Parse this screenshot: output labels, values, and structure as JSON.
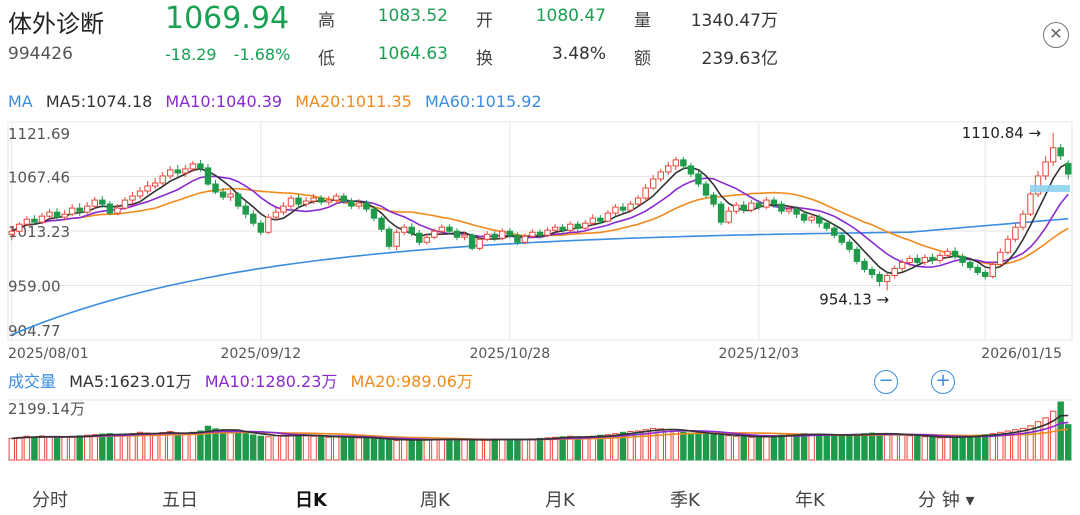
{
  "header": {
    "name": "体外诊断",
    "code": "994426",
    "price": "1069.94",
    "change": "-18.29",
    "change_pct": "-1.68%",
    "stats": [
      {
        "label": "高",
        "value": "1083.52",
        "color": "green"
      },
      {
        "label": "开",
        "value": "1080.47",
        "color": "green"
      },
      {
        "label": "量",
        "value": "1340.47万",
        "color": "dark"
      },
      {
        "label": "低",
        "value": "1064.63",
        "color": "green"
      },
      {
        "label": "换",
        "value": "3.48%",
        "color": "dark"
      },
      {
        "label": "额",
        "value": "239.63亿",
        "color": "dark"
      }
    ],
    "close_icon": "close-icon"
  },
  "ma_legend": {
    "label": "MA",
    "ma5": "MA5:1074.18",
    "ma10": "MA10:1040.39",
    "ma20": "MA20:1011.35",
    "ma60": "MA60:1015.92"
  },
  "vol_legend": {
    "label": "成交量",
    "ma5": "MA5:1623.01万",
    "ma10": "MA10:1280.23万",
    "ma20": "MA20:989.06万"
  },
  "zoom": {
    "minus": "−",
    "plus": "+"
  },
  "tabs": [
    {
      "label": "分时",
      "active": false
    },
    {
      "label": "五日",
      "active": false
    },
    {
      "label": "日K",
      "active": true
    },
    {
      "label": "周K",
      "active": false
    },
    {
      "label": "月K",
      "active": false
    },
    {
      "label": "季K",
      "active": false
    },
    {
      "label": "年K",
      "active": false
    },
    {
      "label": "分 钟 ▾",
      "active": false
    }
  ],
  "colors": {
    "up": "#e8473a",
    "down": "#1e9a4a",
    "ma5": "#333333",
    "ma10": "#8a2ad0",
    "ma20": "#f08a1c",
    "ma60": "#3a8de0",
    "grid": "#e6e6e6"
  },
  "chart_data": {
    "type": "candlestick",
    "y_ticks": [
      "1121.69",
      "1067.46",
      "1013.23",
      "959.00",
      "904.77"
    ],
    "ylim": [
      904.77,
      1121.69
    ],
    "x_ticks": [
      "2025/08/01",
      "2025/09/12",
      "2025/10/28",
      "2025/12/03",
      "2026/01/15"
    ],
    "annotations": [
      {
        "text": "1110.84",
        "value": 1110.84
      },
      {
        "text": "954.13",
        "value": 954.13
      }
    ],
    "volume_top_label": "2199.14万",
    "volume_max": 2199.14,
    "candles": [
      [
        1010,
        1013,
        1004,
        1018
      ],
      [
        1013,
        1020,
        1011,
        1022
      ],
      [
        1020,
        1025,
        1018,
        1028
      ],
      [
        1025,
        1022,
        1019,
        1029
      ],
      [
        1022,
        1028,
        1020,
        1031
      ],
      [
        1028,
        1032,
        1025,
        1035
      ],
      [
        1032,
        1027,
        1024,
        1036
      ],
      [
        1027,
        1030,
        1024,
        1034
      ],
      [
        1030,
        1036,
        1028,
        1040
      ],
      [
        1036,
        1032,
        1028,
        1041
      ],
      [
        1032,
        1038,
        1030,
        1042
      ],
      [
        1038,
        1044,
        1035,
        1047
      ],
      [
        1044,
        1040,
        1036,
        1048
      ],
      [
        1040,
        1031,
        1029,
        1043
      ],
      [
        1031,
        1036,
        1029,
        1040
      ],
      [
        1036,
        1044,
        1034,
        1047
      ],
      [
        1044,
        1048,
        1040,
        1052
      ],
      [
        1048,
        1053,
        1045,
        1057
      ],
      [
        1053,
        1058,
        1050,
        1063
      ],
      [
        1058,
        1061,
        1055,
        1066
      ],
      [
        1061,
        1068,
        1058,
        1072
      ],
      [
        1068,
        1074,
        1065,
        1078
      ],
      [
        1074,
        1071,
        1067,
        1079
      ],
      [
        1071,
        1075,
        1067,
        1079
      ],
      [
        1075,
        1080,
        1072,
        1083
      ],
      [
        1080,
        1076,
        1072,
        1084
      ],
      [
        1076,
        1060,
        1058,
        1080
      ],
      [
        1060,
        1052,
        1050,
        1064
      ],
      [
        1052,
        1047,
        1044,
        1056
      ],
      [
        1047,
        1050,
        1043,
        1054
      ],
      [
        1050,
        1038,
        1035,
        1052
      ],
      [
        1038,
        1030,
        1026,
        1042
      ],
      [
        1030,
        1021,
        1018,
        1034
      ],
      [
        1021,
        1012,
        1009,
        1024
      ],
      [
        1012,
        1027,
        1010,
        1030
      ],
      [
        1027,
        1032,
        1024,
        1036
      ],
      [
        1032,
        1038,
        1029,
        1042
      ],
      [
        1038,
        1046,
        1035,
        1049
      ],
      [
        1046,
        1040,
        1036,
        1050
      ],
      [
        1040,
        1043,
        1037,
        1047
      ],
      [
        1043,
        1046,
        1040,
        1050
      ],
      [
        1046,
        1042,
        1039,
        1049
      ],
      [
        1042,
        1044,
        1039,
        1048
      ],
      [
        1044,
        1048,
        1040,
        1051
      ],
      [
        1048,
        1043,
        1040,
        1051
      ],
      [
        1043,
        1038,
        1035,
        1046
      ],
      [
        1038,
        1041,
        1035,
        1045
      ],
      [
        1041,
        1035,
        1032,
        1044
      ],
      [
        1035,
        1026,
        1023,
        1038
      ],
      [
        1026,
        1015,
        1012,
        1028
      ],
      [
        1015,
        998,
        995,
        1018
      ],
      [
        998,
        1012,
        994,
        1015
      ],
      [
        1012,
        1017,
        1009,
        1020
      ],
      [
        1017,
        1011,
        1008,
        1021
      ],
      [
        1011,
        1002,
        999,
        1014
      ],
      [
        1002,
        1007,
        1000,
        1010
      ],
      [
        1007,
        1013,
        1005,
        1016
      ],
      [
        1013,
        1017,
        1010,
        1020
      ],
      [
        1017,
        1013,
        1010,
        1020
      ],
      [
        1013,
        1007,
        1004,
        1016
      ],
      [
        1007,
        1009,
        1004,
        1012
      ],
      [
        1009,
        996,
        994,
        1011
      ],
      [
        996,
        1005,
        994,
        1008
      ],
      [
        1005,
        1010,
        1003,
        1013
      ],
      [
        1010,
        1006,
        1003,
        1013
      ],
      [
        1006,
        1013,
        1004,
        1016
      ],
      [
        1013,
        1009,
        1006,
        1016
      ],
      [
        1009,
        1002,
        999,
        1012
      ],
      [
        1002,
        1008,
        1000,
        1011
      ],
      [
        1008,
        1012,
        1006,
        1015
      ],
      [
        1012,
        1009,
        1006,
        1015
      ],
      [
        1009,
        1014,
        1007,
        1017
      ],
      [
        1014,
        1017,
        1012,
        1020
      ],
      [
        1017,
        1014,
        1011,
        1020
      ],
      [
        1014,
        1020,
        1012,
        1023
      ],
      [
        1020,
        1016,
        1013,
        1023
      ],
      [
        1016,
        1021,
        1014,
        1024
      ],
      [
        1021,
        1026,
        1019,
        1030
      ],
      [
        1026,
        1023,
        1020,
        1029
      ],
      [
        1023,
        1031,
        1022,
        1034
      ],
      [
        1031,
        1037,
        1028,
        1040
      ],
      [
        1037,
        1034,
        1031,
        1041
      ],
      [
        1034,
        1040,
        1032,
        1043
      ],
      [
        1040,
        1046,
        1038,
        1049
      ],
      [
        1046,
        1056,
        1044,
        1060
      ],
      [
        1056,
        1065,
        1054,
        1069
      ],
      [
        1065,
        1072,
        1062,
        1075
      ],
      [
        1072,
        1078,
        1069,
        1082
      ],
      [
        1078,
        1084,
        1074,
        1087
      ],
      [
        1084,
        1078,
        1074,
        1087
      ],
      [
        1078,
        1070,
        1067,
        1081
      ],
      [
        1070,
        1060,
        1057,
        1073
      ],
      [
        1060,
        1049,
        1046,
        1063
      ],
      [
        1049,
        1040,
        1037,
        1052
      ],
      [
        1040,
        1022,
        1019,
        1043
      ],
      [
        1022,
        1033,
        1020,
        1037
      ],
      [
        1033,
        1039,
        1030,
        1042
      ],
      [
        1039,
        1034,
        1031,
        1043
      ],
      [
        1034,
        1041,
        1032,
        1044
      ],
      [
        1041,
        1037,
        1034,
        1044
      ],
      [
        1037,
        1044,
        1035,
        1047
      ],
      [
        1044,
        1040,
        1036,
        1047
      ],
      [
        1040,
        1033,
        1030,
        1043
      ],
      [
        1033,
        1035,
        1030,
        1039
      ],
      [
        1035,
        1030,
        1026,
        1038
      ],
      [
        1030,
        1024,
        1021,
        1033
      ],
      [
        1024,
        1027,
        1021,
        1031
      ],
      [
        1027,
        1021,
        1017,
        1030
      ],
      [
        1021,
        1016,
        1013,
        1024
      ],
      [
        1016,
        1009,
        1006,
        1019
      ],
      [
        1009,
        1002,
        999,
        1012
      ],
      [
        1002,
        995,
        992,
        1005
      ],
      [
        995,
        983,
        980,
        998
      ],
      [
        983,
        975,
        972,
        986
      ],
      [
        975,
        970,
        966,
        978
      ],
      [
        970,
        963,
        958,
        973
      ],
      [
        963,
        969,
        954.13,
        972
      ],
      [
        969,
        976,
        966,
        979
      ],
      [
        976,
        982,
        973,
        985
      ],
      [
        982,
        986,
        978,
        989
      ],
      [
        986,
        982,
        979,
        990
      ],
      [
        982,
        987,
        979,
        990
      ],
      [
        987,
        984,
        980,
        991
      ],
      [
        984,
        989,
        981,
        992
      ],
      [
        989,
        993,
        986,
        996
      ],
      [
        993,
        988,
        985,
        997
      ],
      [
        988,
        982,
        978,
        991
      ],
      [
        982,
        977,
        974,
        985
      ],
      [
        977,
        972,
        969,
        980
      ],
      [
        972,
        968,
        965,
        975
      ],
      [
        968,
        980,
        966,
        983
      ],
      [
        980,
        992,
        978,
        996
      ],
      [
        992,
        1005,
        990,
        1009
      ],
      [
        1005,
        1017,
        1002,
        1021
      ],
      [
        1017,
        1030,
        1014,
        1034
      ],
      [
        1030,
        1050,
        1028,
        1055
      ],
      [
        1050,
        1068,
        1047,
        1073
      ],
      [
        1068,
        1082,
        1064,
        1088
      ],
      [
        1082,
        1096,
        1078,
        1110.84
      ],
      [
        1096,
        1088,
        1084,
        1100
      ],
      [
        1080.47,
        1069.94,
        1064.63,
        1083.52
      ]
    ],
    "volumes": [
      820,
      860,
      900,
      880,
      910,
      870,
      850,
      880,
      900,
      920,
      940,
      960,
      980,
      1000,
      950,
      980,
      1000,
      1050,
      1020,
      980,
      1040,
      1080,
      1000,
      980,
      1050,
      1100,
      1280,
      1180,
      1100,
      1050,
      1080,
      1000,
      950,
      900,
      880,
      920,
      940,
      960,
      950,
      920,
      900,
      880,
      860,
      870,
      880,
      860,
      840,
      820,
      800,
      780,
      760,
      740,
      760,
      780,
      770,
      760,
      780,
      800,
      790,
      780,
      760,
      740,
      760,
      780,
      800,
      790,
      780,
      760,
      780,
      800,
      820,
      840,
      860,
      880,
      900,
      880,
      860,
      900,
      940,
      960,
      1000,
      1050,
      1080,
      1100,
      1150,
      1200,
      1180,
      1150,
      1100,
      1050,
      1020,
      1000,
      980,
      960,
      940,
      920,
      900,
      880,
      860,
      880,
      900,
      920,
      940,
      960,
      980,
      1000,
      980,
      960,
      940,
      920,
      940,
      960,
      980,
      1000,
      1020,
      1000,
      980,
      960,
      940,
      920,
      900,
      880,
      860,
      840,
      860,
      880,
      900,
      920,
      940,
      960,
      1000,
      1050,
      1100,
      1150,
      1200,
      1300,
      1450,
      1600,
      1850,
      2199.14,
      1340.47
    ]
  }
}
